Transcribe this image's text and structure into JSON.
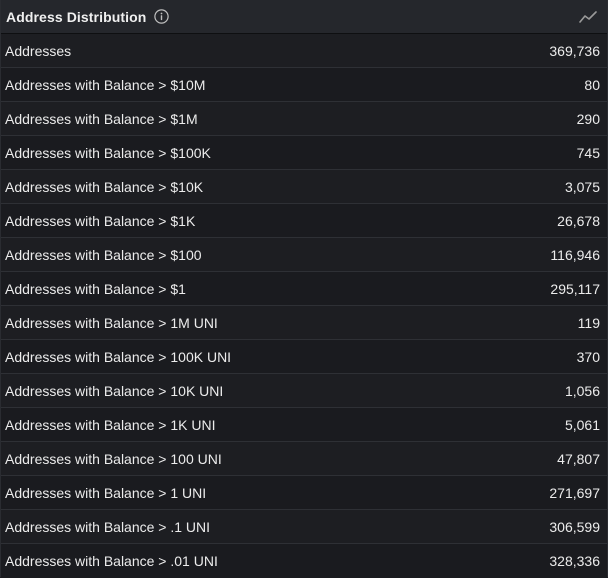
{
  "widget": {
    "title": "Address Distribution",
    "info_icon": "info-circle-icon",
    "chart_icon": "line-chart-icon"
  },
  "rows": [
    {
      "label": "Addresses",
      "value": "369,736"
    },
    {
      "label": "Addresses with Balance > $10M",
      "value": "80"
    },
    {
      "label": "Addresses with Balance > $1M",
      "value": "290"
    },
    {
      "label": "Addresses with Balance > $100K",
      "value": "745"
    },
    {
      "label": "Addresses with Balance > $10K",
      "value": "3,075"
    },
    {
      "label": "Addresses with Balance > $1K",
      "value": "26,678"
    },
    {
      "label": "Addresses with Balance > $100",
      "value": "116,946"
    },
    {
      "label": "Addresses with Balance > $1",
      "value": "295,117"
    },
    {
      "label": "Addresses with Balance > 1M UNI",
      "value": "119"
    },
    {
      "label": "Addresses with Balance > 100K UNI",
      "value": "370"
    },
    {
      "label": "Addresses with Balance > 10K UNI",
      "value": "1,056"
    },
    {
      "label": "Addresses with Balance > 1K UNI",
      "value": "5,061"
    },
    {
      "label": "Addresses with Balance > 100 UNI",
      "value": "47,807"
    },
    {
      "label": "Addresses with Balance > 1 UNI",
      "value": "271,697"
    },
    {
      "label": "Addresses with Balance > .1 UNI",
      "value": "306,599"
    },
    {
      "label": "Addresses with Balance > .01 UNI",
      "value": "328,336"
    }
  ]
}
